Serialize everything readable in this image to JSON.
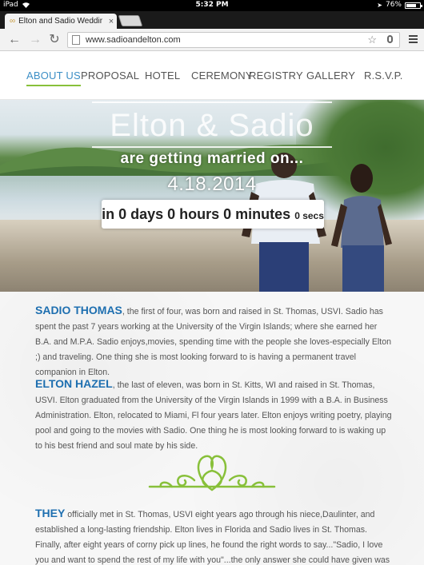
{
  "status_bar": {
    "device": "iPad",
    "time": "5:32 PM",
    "battery": "76%",
    "battery_fraction": 0.76
  },
  "browser": {
    "tab_title": "Elton and Sadio Wedding",
    "url": "www.sadioandelton.com"
  },
  "site_nav": {
    "items": [
      {
        "label": "ABOUT US",
        "active": true
      },
      {
        "label": "PROPOSAL"
      },
      {
        "label": "HOTEL"
      },
      {
        "label": "CEREMONY"
      },
      {
        "label": "REGISTRY"
      },
      {
        "label": "GALLERY"
      },
      {
        "label": "R.S.V.P."
      }
    ]
  },
  "hero": {
    "title": "Elton & Sadio",
    "subtitle": "are getting married on...",
    "date": "4.18.2014",
    "countdown_main": "in 0 days 0 hours 0 minutes ",
    "countdown_secs": "0 secs"
  },
  "about": {
    "sadio": {
      "lead": "SADIO THOMAS",
      "text": ", the first of four, was born and raised in St. Thomas, USVI. Sadio has spent the past 7 years working at the University of the Virgin Islands; where she earned her B.A. and M.P.A. Sadio enjoys,movies, spending time with the people she loves-especially Elton ;) and traveling. One thing she is most looking forward to is having a permanent travel companion in Elton."
    },
    "elton": {
      "lead": "ELTON HAZEL",
      "text": ", the last of eleven, was born in St. Kitts, WI and raised in St. Thomas, USVI. Elton graduated from the University of the Virgin Islands in 1999 with a B.A. in Business Administration. Elton, relocated to Miami, Fl four years later. Elton enjoys writing poetry, playing pool and going to the movies with Sadio. One thing he is most looking forward to is waking up to his best friend and soul mate by his side."
    },
    "they": {
      "lead": "THEY",
      "text": " officially met in St. Thomas, USVI eight years ago through his niece,Daulinter, and established a long-lasting friendship. Elton lives in Florida and Sadio lives in St. Thomas. Finally, after eight years of corny pick up lines, he found the right words to say...\"Sadio, I love you and want to spend the rest of my life with you\"...the only answer she could have given was \"yes\"."
    }
  },
  "colors": {
    "accent_blue": "#3d8fc6",
    "accent_green": "#88c03a",
    "lead_blue": "#1e6fb0"
  }
}
